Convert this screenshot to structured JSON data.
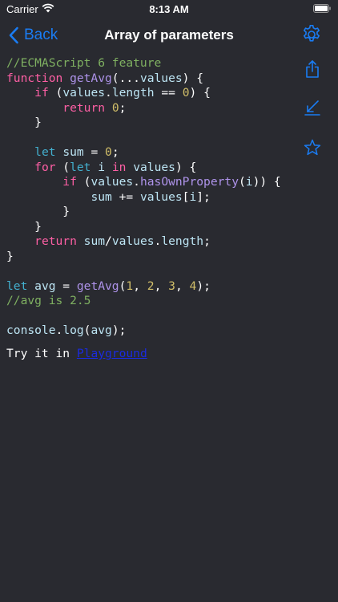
{
  "status_bar": {
    "carrier": "Carrier",
    "time": "8:13 AM"
  },
  "nav": {
    "back_label": "Back",
    "title": "Array of parameters"
  },
  "code_lines": [
    [
      {
        "t": "//ECMAScript 6 feature",
        "c": "com"
      }
    ],
    [
      {
        "t": "function ",
        "c": "kw"
      },
      {
        "t": "getAvg",
        "c": "fn"
      },
      {
        "t": "(...",
        "c": "pl"
      },
      {
        "t": "values",
        "c": "id"
      },
      {
        "t": ") {",
        "c": "pl"
      }
    ],
    [
      {
        "t": "    ",
        "c": "pl"
      },
      {
        "t": "if",
        "c": "kw"
      },
      {
        "t": " (",
        "c": "pl"
      },
      {
        "t": "values",
        "c": "id"
      },
      {
        "t": ".",
        "c": "pl"
      },
      {
        "t": "length",
        "c": "id"
      },
      {
        "t": " == ",
        "c": "pl"
      },
      {
        "t": "0",
        "c": "num"
      },
      {
        "t": ") {",
        "c": "pl"
      }
    ],
    [
      {
        "t": "        ",
        "c": "pl"
      },
      {
        "t": "return",
        "c": "kw"
      },
      {
        "t": " ",
        "c": "pl"
      },
      {
        "t": "0",
        "c": "num"
      },
      {
        "t": ";",
        "c": "pl"
      }
    ],
    [
      {
        "t": "    }",
        "c": "pl"
      }
    ],
    [],
    [
      {
        "t": "    ",
        "c": "pl"
      },
      {
        "t": "let",
        "c": "kw2"
      },
      {
        "t": " ",
        "c": "pl"
      },
      {
        "t": "sum",
        "c": "id"
      },
      {
        "t": " = ",
        "c": "pl"
      },
      {
        "t": "0",
        "c": "num"
      },
      {
        "t": ";",
        "c": "pl"
      }
    ],
    [
      {
        "t": "    ",
        "c": "pl"
      },
      {
        "t": "for",
        "c": "kw"
      },
      {
        "t": " (",
        "c": "pl"
      },
      {
        "t": "let",
        "c": "kw2"
      },
      {
        "t": " ",
        "c": "pl"
      },
      {
        "t": "i",
        "c": "id"
      },
      {
        "t": " ",
        "c": "pl"
      },
      {
        "t": "in",
        "c": "kw"
      },
      {
        "t": " ",
        "c": "pl"
      },
      {
        "t": "values",
        "c": "id"
      },
      {
        "t": ") {",
        "c": "pl"
      }
    ],
    [
      {
        "t": "        ",
        "c": "pl"
      },
      {
        "t": "if",
        "c": "kw"
      },
      {
        "t": " (",
        "c": "pl"
      },
      {
        "t": "values",
        "c": "id"
      },
      {
        "t": ".",
        "c": "pl"
      },
      {
        "t": "hasOwnProperty",
        "c": "fn"
      },
      {
        "t": "(",
        "c": "pl"
      },
      {
        "t": "i",
        "c": "id"
      },
      {
        "t": ")) {",
        "c": "pl"
      }
    ],
    [
      {
        "t": "            ",
        "c": "pl"
      },
      {
        "t": "sum",
        "c": "id"
      },
      {
        "t": " += ",
        "c": "pl"
      },
      {
        "t": "values",
        "c": "id"
      },
      {
        "t": "[",
        "c": "pl"
      },
      {
        "t": "i",
        "c": "id"
      },
      {
        "t": "];",
        "c": "pl"
      }
    ],
    [
      {
        "t": "        }",
        "c": "pl"
      }
    ],
    [
      {
        "t": "    }",
        "c": "pl"
      }
    ],
    [
      {
        "t": "    ",
        "c": "pl"
      },
      {
        "t": "return",
        "c": "kw"
      },
      {
        "t": " ",
        "c": "pl"
      },
      {
        "t": "sum",
        "c": "id"
      },
      {
        "t": "/",
        "c": "pl"
      },
      {
        "t": "values",
        "c": "id"
      },
      {
        "t": ".",
        "c": "pl"
      },
      {
        "t": "length",
        "c": "id"
      },
      {
        "t": ";",
        "c": "pl"
      }
    ],
    [
      {
        "t": "}",
        "c": "pl"
      }
    ],
    [],
    [
      {
        "t": "let",
        "c": "kw2"
      },
      {
        "t": " ",
        "c": "pl"
      },
      {
        "t": "avg",
        "c": "id"
      },
      {
        "t": " = ",
        "c": "pl"
      },
      {
        "t": "getAvg",
        "c": "fn"
      },
      {
        "t": "(",
        "c": "pl"
      },
      {
        "t": "1",
        "c": "num"
      },
      {
        "t": ", ",
        "c": "pl"
      },
      {
        "t": "2",
        "c": "num"
      },
      {
        "t": ", ",
        "c": "pl"
      },
      {
        "t": "3",
        "c": "num"
      },
      {
        "t": ", ",
        "c": "pl"
      },
      {
        "t": "4",
        "c": "num"
      },
      {
        "t": ");",
        "c": "pl"
      }
    ],
    [
      {
        "t": "//avg is 2.5",
        "c": "com"
      }
    ],
    [],
    [
      {
        "t": "console",
        "c": "id"
      },
      {
        "t": ".",
        "c": "pl"
      },
      {
        "t": "log",
        "c": "id"
      },
      {
        "t": "(",
        "c": "pl"
      },
      {
        "t": "avg",
        "c": "id"
      },
      {
        "t": ");",
        "c": "pl"
      }
    ]
  ],
  "footer": {
    "prefix": "Try it in ",
    "link_label": "Playground"
  },
  "icons": {
    "back": "chevron-left-icon",
    "settings": "gear-icon",
    "share": "share-icon",
    "edit": "edit-icon",
    "favorite": "star-icon",
    "wifi": "wifi-icon",
    "battery": "battery-icon"
  },
  "colors": {
    "background": "#292a30",
    "accent": "#1a7cf3",
    "comment": "#7fb061",
    "keyword": "#fd5fa4",
    "keyword_let": "#43b0cf",
    "function": "#ae93ea",
    "identifier": "#bde5f4",
    "number": "#d2bf69",
    "link": "#1a2be0"
  }
}
